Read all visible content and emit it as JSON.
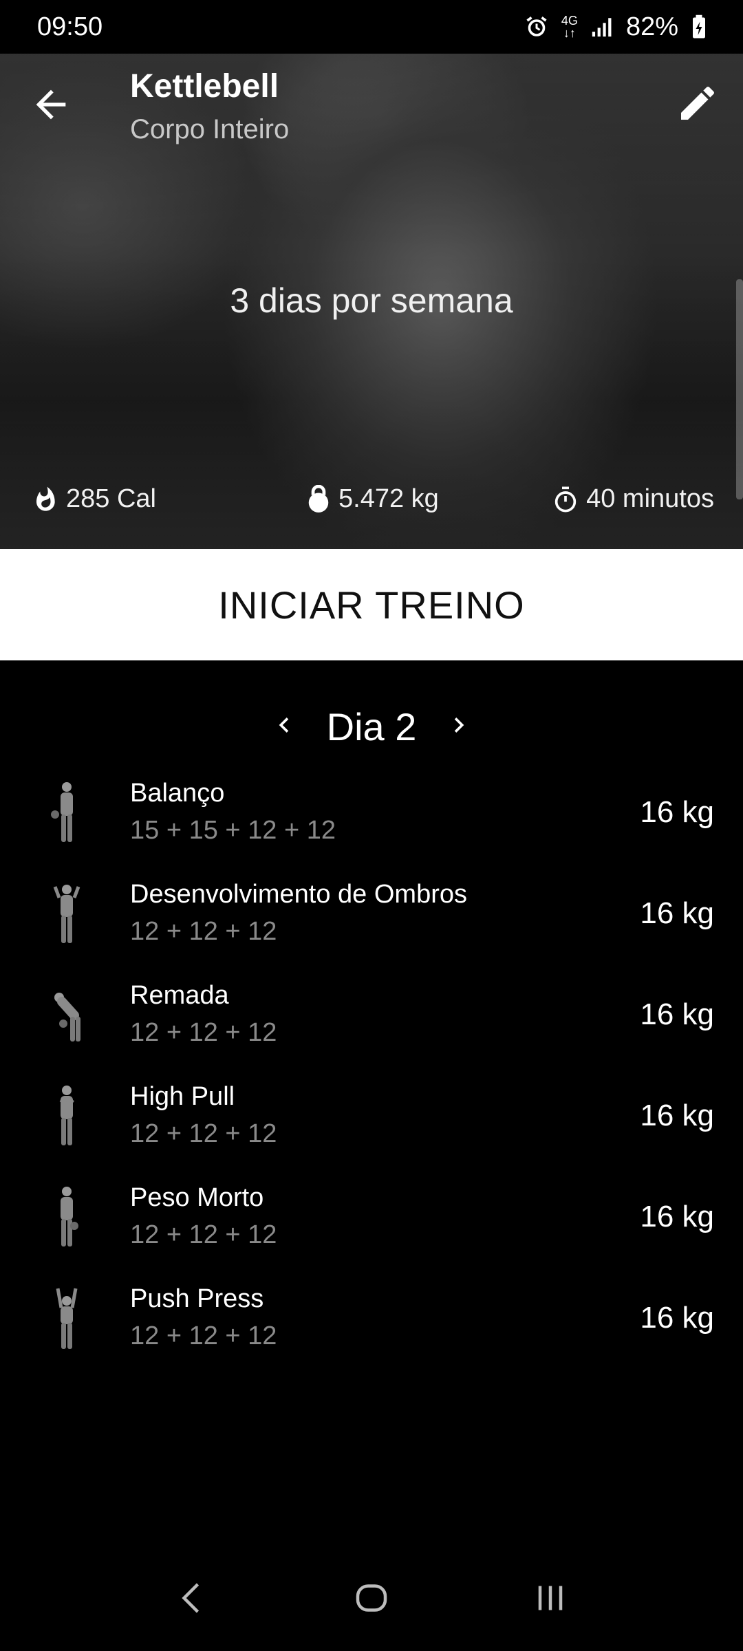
{
  "status_bar": {
    "time": "09:50",
    "network": "4G",
    "battery": "82%",
    "icons": [
      "alarm-icon",
      "network-4g-icon",
      "signal-icon",
      "battery-charging-icon"
    ]
  },
  "header": {
    "title": "Kettlebell",
    "subtitle": "Corpo Inteiro",
    "frequency": "3 dias por semana",
    "back_icon": "arrow-left-icon",
    "edit_icon": "pencil-icon"
  },
  "stats": {
    "calories": "285 Cal",
    "weight": "5.472 kg",
    "duration": "40 minutos"
  },
  "start_button": {
    "label": "INICIAR TREINO"
  },
  "day_nav": {
    "label": "Dia 2",
    "prev_icon": "chevron-left-icon",
    "next_icon": "chevron-right-icon"
  },
  "exercises": [
    {
      "name": "Balanço",
      "sets": "15 + 15 + 12 + 12",
      "weight": "16 kg"
    },
    {
      "name": "Desenvolvimento de Ombros",
      "sets": "12 + 12 + 12",
      "weight": "16 kg"
    },
    {
      "name": "Remada",
      "sets": "12 + 12 + 12",
      "weight": "16 kg"
    },
    {
      "name": "High Pull",
      "sets": "12 + 12 + 12",
      "weight": "16 kg"
    },
    {
      "name": "Peso Morto",
      "sets": "12 + 12 + 12",
      "weight": "16 kg"
    },
    {
      "name": "Push Press",
      "sets": "12 + 12 + 12",
      "weight": "16 kg"
    }
  ],
  "colors": {
    "background": "#000000",
    "start_button_bg": "#ffffff",
    "secondary_text": "#8a8a8a"
  }
}
